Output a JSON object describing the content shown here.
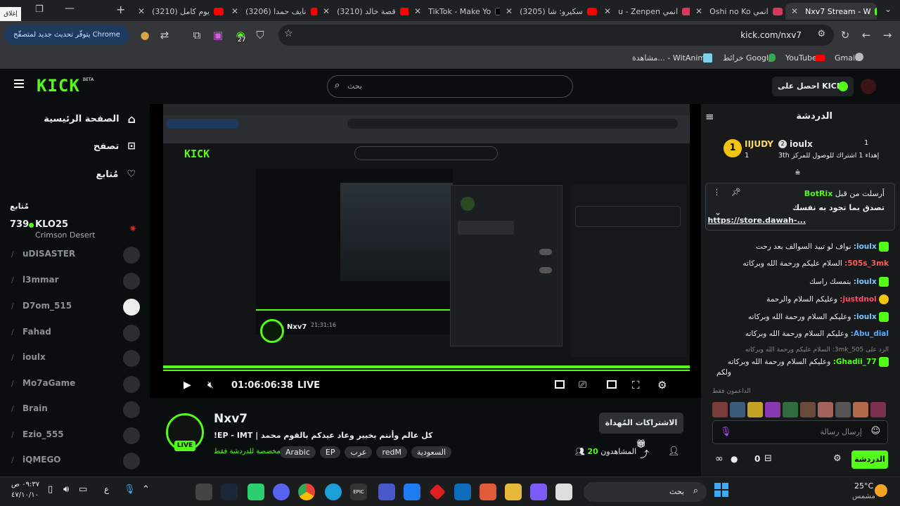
{
  "browser": {
    "tabs": [
      {
        "label": "Nxv7 Stream - W",
        "active": true
      },
      {
        "label": "Oshi no Ko انمي"
      },
      {
        "label": "u - Zenpen انمي"
      },
      {
        "label": "(3205) سكيرو: شا"
      },
      {
        "label": "TikTok - Make Yo"
      },
      {
        "label": "(3210) قصة خالد"
      },
      {
        "label": "(3206) نايف حمدا"
      },
      {
        "label": "(3210) يوم كامل"
      }
    ],
    "close_tooltip": "إغلاق",
    "url": "kick.com/nxv7",
    "update_label": "يتوفّر تحديث جديد لمتصفّح Chrome",
    "extension_badge": "27",
    "bookmarks": [
      "Gmail",
      "YouTube",
      "خرائط Google",
      "مشاهدة... - WitAnime"
    ]
  },
  "header": {
    "logo": "KICK",
    "logo_tag": "BETA",
    "search_placeholder": "بحث",
    "get_kicks": "احصل على KICKs"
  },
  "sidebar": {
    "nav": [
      "الصفحة الرئيسية",
      "تصفح",
      "مُتابع"
    ],
    "following_title": "مُتابع",
    "live_channel": {
      "name": "KLO25",
      "viewers": "739",
      "game": "Crimson Desert"
    },
    "channels": [
      "uDISASTER",
      "l3mmar",
      "D7om_515",
      "Fahad",
      "ioulx",
      "Mo7aGame",
      "Brain",
      "Ezio_555",
      "iQMEGO"
    ]
  },
  "player": {
    "time": "01:06:06:38",
    "live": "LIVE",
    "inner_time": "21:31:16"
  },
  "stream": {
    "channel": "Nxv7",
    "title": "كل عالم وأنتم بخيير وعاد عيدكم بالقوم محمد | EP - IMT!",
    "tags": [
      "السعودية",
      "redM",
      "عرب",
      "EP",
      "Arabic"
    ],
    "chat_mode": "مخصصة للدردشة فقط",
    "viewers_label": "المشاهدون",
    "viewers": "20",
    "subs_button": "الاشتراكات المُهداة",
    "live_badge": "LIVE"
  },
  "chat": {
    "title": "الدردشة",
    "leader1": {
      "name": "ioulx",
      "rank": "2",
      "count": "1"
    },
    "leader2": {
      "name": "IIJUDY",
      "rank": "1",
      "count": "1"
    },
    "gift_text": "إهداء 1 اشتراك للوصول للمركز 3",
    "gift_tail": "th",
    "pinned_by": "أرسلت من قبل",
    "pinned_user": "BotRix",
    "pinned_text": "تصدق بما تجود به نفسك",
    "pinned_link": "https://store.dawah-...",
    "messages": [
      {
        "user": "ioulx:",
        "text": "نواف لو تبيد السوالف بعد رحت",
        "color": "#7ec8ff"
      },
      {
        "user": "505s_3mk:",
        "text": "السلام عليكم ورحمة الله وبركاته",
        "color": "#ff5b5b"
      },
      {
        "user": "ioulx:",
        "text": "بتمسك راسك",
        "color": "#7ec8ff"
      },
      {
        "user": "justdnol:",
        "text": "وعليكم السلام والرحمة",
        "color": "#ff4d6d"
      },
      {
        "user": "ioulx:",
        "text": "وعليكم السلام ورحمة الله وبركاته",
        "color": "#7ec8ff"
      },
      {
        "user": "Abu_dial:",
        "text": "وعليكم السلام ورحمة الله وبركاته",
        "color": "#5aa8ff"
      }
    ],
    "reply_text": "الرد على 505_3mk: السلام عليكم ورحمة الله وبركاته",
    "last_msg": {
      "user": "Ghadii_77:",
      "text": "وعليكم السلام ورحمة الله وبركاته",
      "tail": "ولكم"
    },
    "top_gifters": "الداعمون فقط",
    "input_placeholder": "إرسال رسالة",
    "send_button": "الدردشة",
    "points": "0"
  },
  "taskbar": {
    "search": "بحث",
    "weather_temp": "25°C",
    "weather_desc": "مشمس",
    "clock_time": "٠٩:٣٧ ص",
    "clock_date": "٤٧/١٠/١٠",
    "lang": "ع"
  }
}
